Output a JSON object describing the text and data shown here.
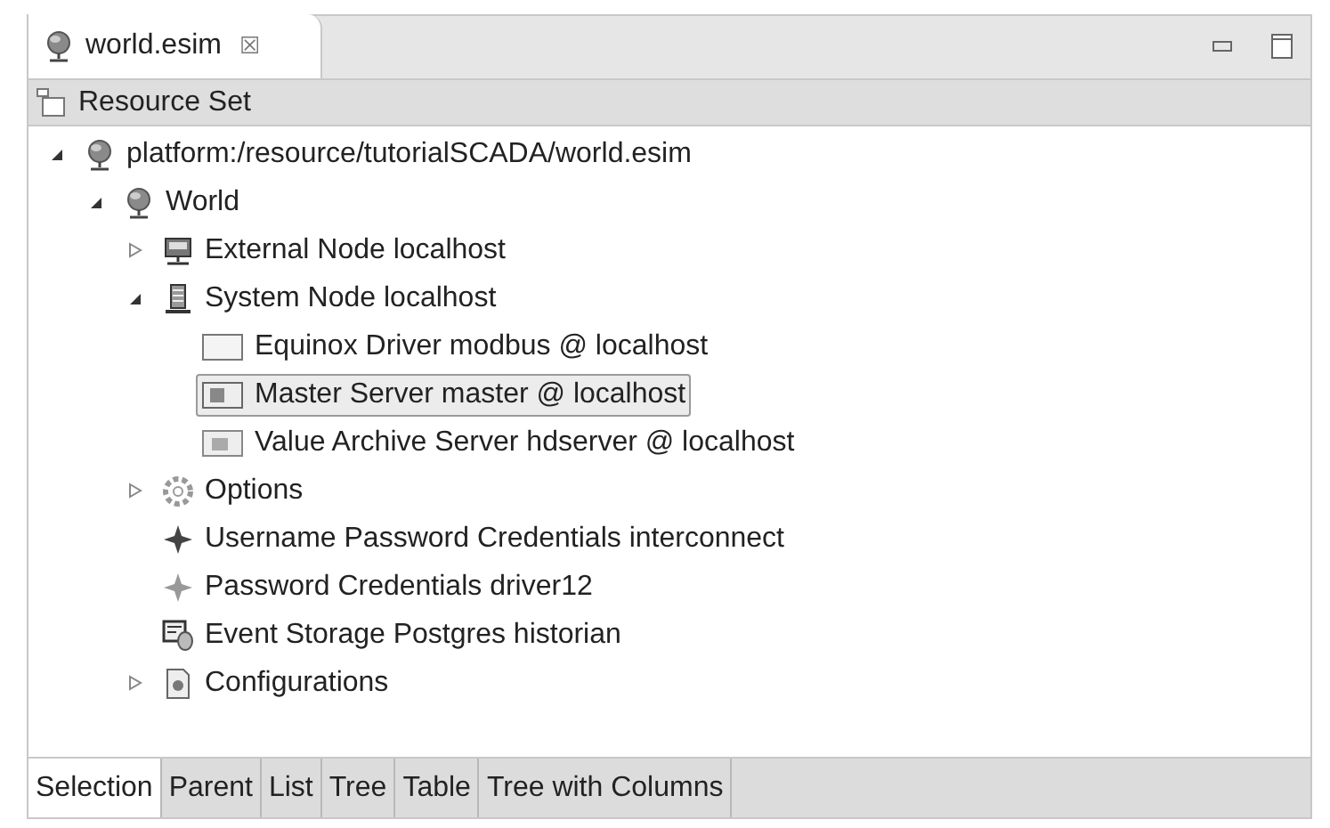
{
  "editor_tab": {
    "title": "world.esim",
    "close": "☒"
  },
  "header": {
    "title": "Resource Set"
  },
  "tree": [
    {
      "label": "platform:/resource/tutorialSCADA/world.esim",
      "kind": "globe",
      "expanded": true,
      "selected": false,
      "children": [
        {
          "label": "World",
          "kind": "globe",
          "expanded": true,
          "selected": false,
          "children": [
            {
              "label": "External Node localhost",
              "kind": "network",
              "expanded": false,
              "selected": false
            },
            {
              "label": "System Node localhost",
              "kind": "server",
              "expanded": true,
              "selected": false,
              "children": [
                {
                  "label": "Equinox Driver modbus @ localhost",
                  "kind": "blank",
                  "selected": false
                },
                {
                  "label": "Master Server master @ localhost",
                  "kind": "master",
                  "selected": true
                },
                {
                  "label": "Value Archive Server hdserver @ localhost",
                  "kind": "archive",
                  "selected": false
                }
              ]
            },
            {
              "label": "Options",
              "kind": "gear",
              "expanded": false,
              "selected": false
            },
            {
              "label": "Username Password Credentials interconnect",
              "kind": "diamond",
              "selected": false
            },
            {
              "label": "Password Credentials driver12",
              "kind": "faint",
              "selected": false
            },
            {
              "label": "Event Storage Postgres historian",
              "kind": "storage",
              "selected": false
            },
            {
              "label": "Configurations",
              "kind": "config",
              "expanded": false,
              "selected": false
            }
          ]
        }
      ]
    }
  ],
  "bottom_tabs": [
    {
      "label": "Selection",
      "selected": true
    },
    {
      "label": "Parent",
      "selected": false
    },
    {
      "label": "List",
      "selected": false
    },
    {
      "label": "Tree",
      "selected": false
    },
    {
      "label": "Table",
      "selected": false
    },
    {
      "label": "Tree with Columns",
      "selected": false
    }
  ]
}
